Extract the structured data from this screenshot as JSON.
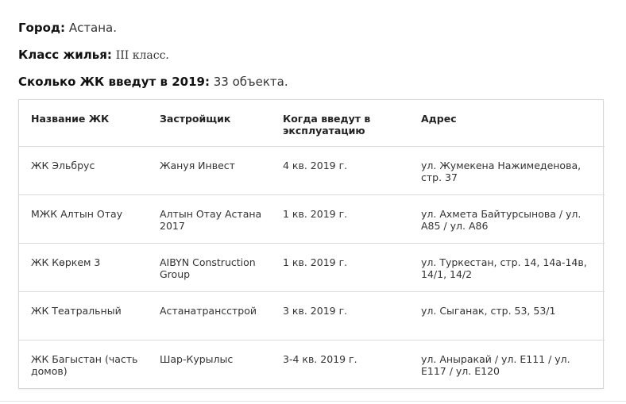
{
  "info": {
    "city_label": "Город:",
    "city_value": "Астана.",
    "class_label": "Класс жилья:",
    "class_value": "III класс.",
    "count_label": "Сколько ЖК введут в 2019:",
    "count_value": "33 объекта."
  },
  "table": {
    "headers": [
      "Название ЖК",
      "Застройщик",
      "Когда введут в эксплуатацию",
      "Адрес"
    ],
    "rows": [
      [
        "ЖК Эльбрус",
        "Жануя Инвест",
        "4 кв. 2019 г.",
        "ул. Жумекена Нажимеденова, стр. 37"
      ],
      [
        "МЖК Алтын Отау",
        "Алтын Отау Астана 2017",
        "1 кв. 2019 г.",
        "ул. Ахмета Байтурсынова / ул. А85 / ул. А86"
      ],
      [
        "ЖК Көркем 3",
        "AIBYN Construction Group",
        "1 кв. 2019 г.",
        "ул. Туркестан, стр. 14, 14а-14в, 14/1, 14/2"
      ],
      [
        "ЖК Театральный",
        "Астанатрансстрой",
        "3 кв. 2019 г.",
        "ул. Сыганак, стр. 53, 53/1"
      ],
      [
        "ЖК Багыстан (часть домов)",
        "Шар-Курылыс",
        "3-4 кв. 2019 г.",
        "ул. Аныракай / ул. Е111 / ул. Е117 / ул. Е120"
      ]
    ]
  }
}
